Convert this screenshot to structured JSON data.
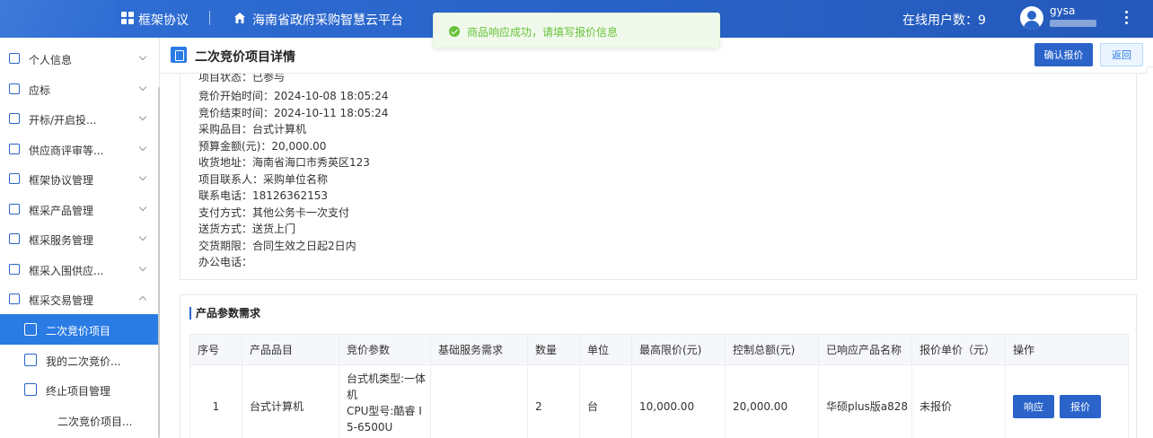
{
  "topbar": {
    "title": "框架协议",
    "platform": "海南省政府采购智慧云平台",
    "online_users": "在线用户数：9",
    "username": "gysa"
  },
  "toast": {
    "message": "商品响应成功，请填写报价信息",
    "color": "#67c23a"
  },
  "sidebar": {
    "items": [
      {
        "label": "个人信息",
        "icon": "user-card-icon"
      },
      {
        "label": "应标",
        "icon": "document-icon"
      },
      {
        "label": "开标/开启投...",
        "icon": "open-bid-icon"
      },
      {
        "label": "供应商评审等...",
        "icon": "review-icon"
      },
      {
        "label": "框架协议管理",
        "icon": "agreement-icon"
      },
      {
        "label": "框采产品管理",
        "icon": "product-icon"
      },
      {
        "label": "框采服务管理",
        "icon": "service-icon"
      },
      {
        "label": "框采入围供应...",
        "icon": "supplier-icon"
      },
      {
        "label": "框采交易管理",
        "icon": "trade-icon"
      }
    ],
    "sub_items": [
      {
        "label": "二次竞价项目",
        "icon": "bid-icon",
        "active": true
      },
      {
        "label": "我的二次竞价...",
        "icon": "my-bid-icon"
      },
      {
        "label": "终止项目管理",
        "icon": "terminate-icon"
      },
      {
        "label": "二次竞价项目..."
      }
    ]
  },
  "page": {
    "title": "二次竞价项目详情",
    "confirm_label": "确认报价",
    "back_label": "返回"
  },
  "info": {
    "cut_line": "项目状态：已参与",
    "lines": [
      "竞价开始时间：2024-10-08 18:05:24",
      "竞价结束时间：2024-10-11 18:05:24",
      "采购品目：台式计算机",
      "预算金额(元)：20,000.00",
      "收货地址：海南省海口市秀英区123",
      "项目联系人：采购单位名称",
      "联系电话：18126362153",
      "支付方式：其他公务卡一次支付",
      "送货方式：送货上门",
      "交货期限：合同生效之日起2日内",
      "办公电话："
    ]
  },
  "products": {
    "title": "产品参数需求",
    "headers": [
      "序号",
      "产品品目",
      "竞价参数",
      "基础服务需求",
      "数量",
      "单位",
      "最高限价(元)",
      "控制总额(元)",
      "已响应产品名称",
      "报价单价（元）",
      "操作"
    ],
    "rows": [
      {
        "no": "1",
        "category": "台式计算机",
        "params_lines": [
          "台式机类型:一体",
          "机",
          "CPU型号:酷睿 I",
          "5-6500U"
        ],
        "service": "",
        "qty": "2",
        "unit": "台",
        "max_price": "10,000.00",
        "total": "20,000.00",
        "responded_product": "华硕plus版a828",
        "quote_price": "未报价",
        "respond_label": "响应",
        "quote_label": "报价"
      }
    ]
  }
}
